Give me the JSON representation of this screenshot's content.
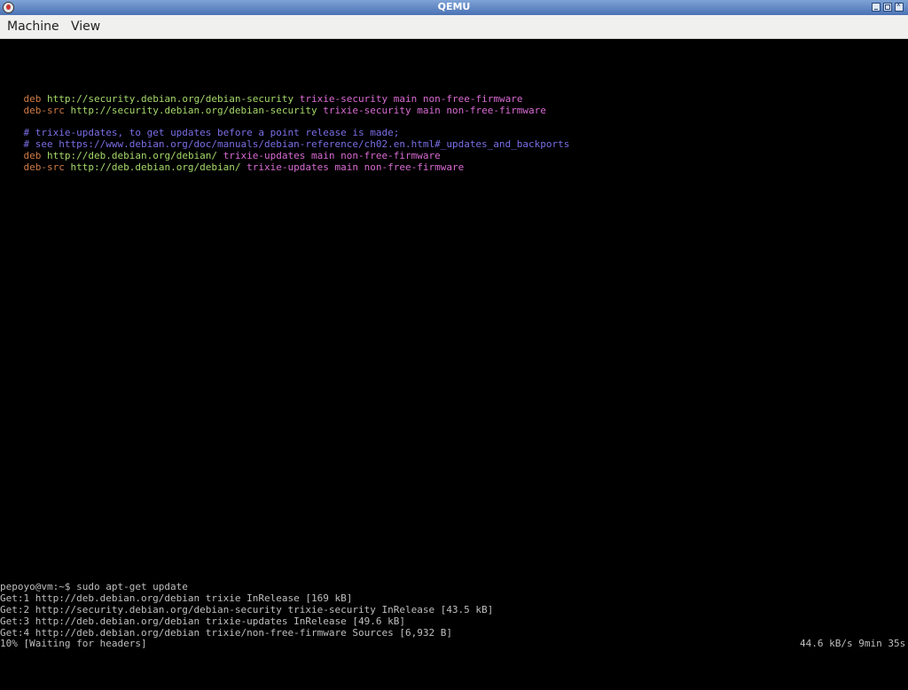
{
  "window": {
    "title": "QEMU"
  },
  "menu": {
    "items": [
      "Machine",
      "View"
    ]
  },
  "colors": {
    "keyword": "#cf7a45",
    "url": "#a5d96a",
    "suite": "#d96bd3",
    "comment": "#7a6ee6",
    "output": "#bfbfbf"
  },
  "editor_lines": [
    {
      "kw": "deb",
      "url": "http://security.debian.org/debian-security",
      "rest": "trixie-security main non-free-firmware"
    },
    {
      "kw": "deb-src",
      "url": "http://security.debian.org/debian-security",
      "rest": "trixie-security main non-free-firmware"
    },
    {
      "comment": "# trixie-updates, to get updates before a point release is made;"
    },
    {
      "comment": "# see https://www.debian.org/doc/manuals/debian-reference/ch02.en.html#_updates_and_backports"
    },
    {
      "kw": "deb",
      "url": "http://deb.debian.org/debian/",
      "rest": "trixie-updates main non-free-firmware"
    },
    {
      "kw": "deb-src",
      "url": "http://deb.debian.org/debian/",
      "rest": "trixie-updates main non-free-firmware"
    }
  ],
  "terminal": {
    "prompt": "pepoyo@vm:~$ sudo apt-get update",
    "output": [
      "Get:1 http://deb.debian.org/debian trixie InRelease [169 kB]",
      "Get:2 http://security.debian.org/debian-security trixie-security InRelease [43.5 kB]",
      "Get:3 http://deb.debian.org/debian trixie-updates InRelease [49.6 kB]",
      "Get:4 http://deb.debian.org/debian trixie/non-free-firmware Sources [6,932 B]"
    ],
    "progress": "10% [Waiting for headers]",
    "rate": "44.6 kB/s 9min 35s"
  }
}
